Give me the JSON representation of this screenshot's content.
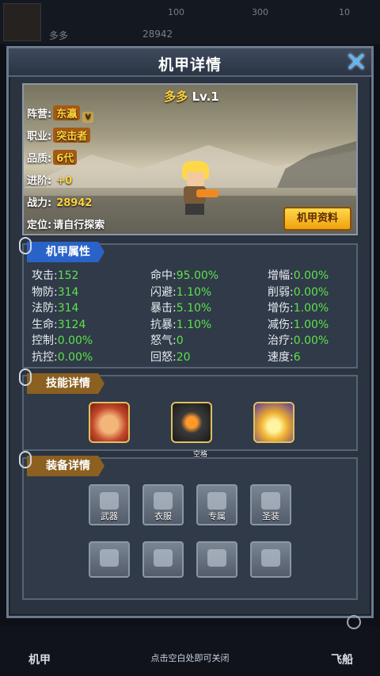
{
  "hud": {
    "player_name": "多多",
    "power": "28942",
    "res1": "100",
    "res2": "300",
    "res3": "10",
    "tab_left": "机甲",
    "tab_right": "飞船"
  },
  "panel": {
    "title": "机甲详情",
    "close_icon": "close-x-icon"
  },
  "hero": {
    "name": "多多",
    "level": "Lv.1",
    "camp_label": "阵营:",
    "camp_value": "东瀛",
    "job_label": "职业:",
    "job_value": "突击者",
    "quality_label": "品质:",
    "quality_value": "6代",
    "advance_label": "进阶:",
    "advance_value": "+0",
    "power_label": "战力:",
    "power_value": "28942",
    "position_label": "定位:",
    "position_value": "请自行探索",
    "info_button": "机甲资料"
  },
  "attributes": {
    "title": "机甲属性",
    "rows": [
      [
        {
          "k": "攻击:",
          "v": "152"
        },
        {
          "k": "命中:",
          "v": "95.00%"
        },
        {
          "k": "增幅:",
          "v": "0.00%"
        }
      ],
      [
        {
          "k": "物防:",
          "v": "314"
        },
        {
          "k": "闪避:",
          "v": "1.10%"
        },
        {
          "k": "削弱:",
          "v": "0.00%"
        }
      ],
      [
        {
          "k": "法防:",
          "v": "314"
        },
        {
          "k": "暴击:",
          "v": "5.10%"
        },
        {
          "k": "增伤:",
          "v": "1.00%"
        }
      ],
      [
        {
          "k": "生命:",
          "v": "3124"
        },
        {
          "k": "抗暴:",
          "v": "1.10%"
        },
        {
          "k": "减伤:",
          "v": "1.00%"
        }
      ],
      [
        {
          "k": "控制:",
          "v": "0.00%"
        },
        {
          "k": "怒气:",
          "v": "0"
        },
        {
          "k": "治疗:",
          "v": "0.00%"
        }
      ],
      [
        {
          "k": "抗控:",
          "v": "0.00%"
        },
        {
          "k": "回怒:",
          "v": "20"
        },
        {
          "k": "速度:",
          "v": "6"
        }
      ]
    ]
  },
  "skills": {
    "title": "技能详情"
  },
  "equipment": {
    "title": "装备详情",
    "empty_tip": "空格",
    "slots": [
      "武器",
      "衣服",
      "专属",
      "圣装"
    ]
  },
  "footer": {
    "close_hint": "点击空白处即可关闭"
  },
  "colors": {
    "accent_blue": "#2a63c8",
    "value_green": "#5ee24c",
    "gold": "#ffd23a"
  }
}
